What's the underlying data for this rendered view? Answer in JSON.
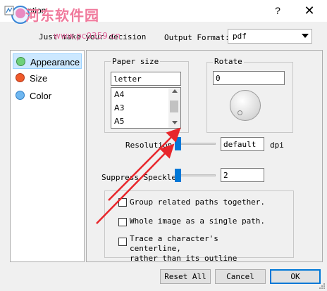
{
  "window": {
    "title": "Option",
    "help_glyph": "?",
    "close_glyph": "✕"
  },
  "watermark": {
    "site_name": "河东软件园",
    "url": "www.pc0359.cn"
  },
  "header": {
    "text": "Just make your decision",
    "output_format_label": "Output Format:",
    "output_format_value": "pdf"
  },
  "sidebar": {
    "items": [
      {
        "label": "Appearance",
        "color": "#6fd17a",
        "selected": true
      },
      {
        "label": "Size",
        "color": "#f05a2a",
        "selected": false
      },
      {
        "label": "Color",
        "color": "#6fb7f0",
        "selected": false
      }
    ]
  },
  "paper_size": {
    "title": "Paper size",
    "value": "letter",
    "options": [
      "A4",
      "A3",
      "A5"
    ]
  },
  "rotate": {
    "title": "Rotate",
    "value": "0"
  },
  "resolution": {
    "label": "Resolution",
    "value": "default",
    "unit": "dpi"
  },
  "suppress_speckle": {
    "label": "Suppress Speckle:",
    "value": "2"
  },
  "options": [
    {
      "label": "Group related paths together.",
      "checked": false
    },
    {
      "label": "Whole image as a single path.",
      "checked": false
    },
    {
      "label_line1": "Trace a character's centerline,",
      "label_line2": "rather than its outline",
      "checked": false
    }
  ],
  "buttons": {
    "reset": "Reset All",
    "cancel": "Cancel",
    "ok": "OK"
  },
  "annotation": {
    "arrow_color": "#e8262b"
  }
}
